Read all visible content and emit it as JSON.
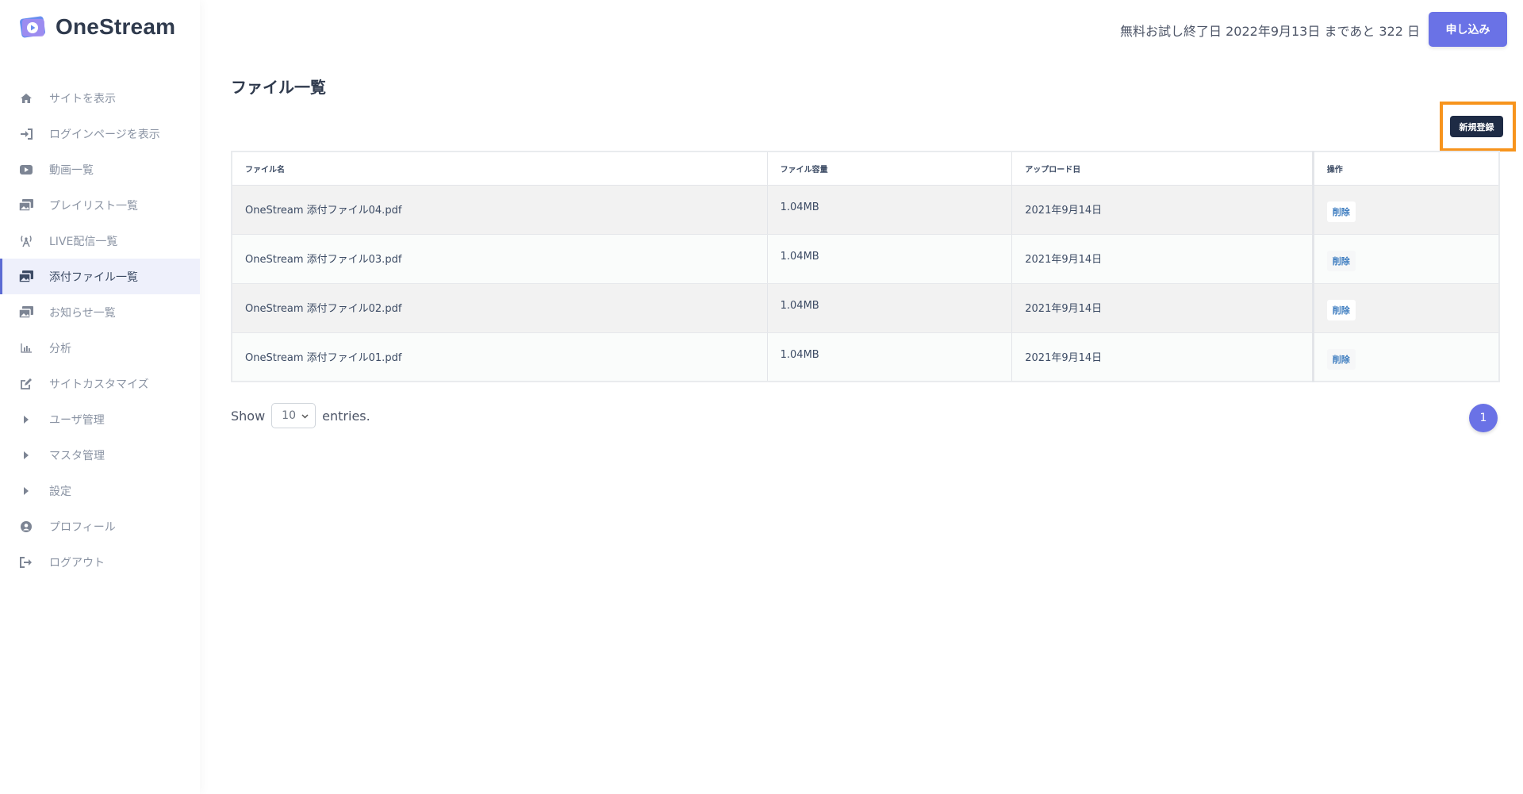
{
  "app": {
    "name": "OneStream"
  },
  "sidebar": {
    "items": [
      {
        "label": "サイトを表示",
        "icon": "home-icon"
      },
      {
        "label": "ログインページを表示",
        "icon": "sign-in-icon"
      },
      {
        "label": "動画一覧",
        "icon": "video-icon"
      },
      {
        "label": "プレイリスト一覧",
        "icon": "images-icon"
      },
      {
        "label": "LIVE配信一覧",
        "icon": "broadcast-icon"
      },
      {
        "label": "添付ファイル一覧",
        "icon": "images-icon",
        "active": true
      },
      {
        "label": "お知らせ一覧",
        "icon": "images-icon"
      },
      {
        "label": "分析",
        "icon": "bar-chart-icon"
      },
      {
        "label": "サイトカスタマイズ",
        "icon": "edit-icon"
      },
      {
        "label": "ユーザ管理",
        "icon": "caret-right-icon"
      },
      {
        "label": "マスタ管理",
        "icon": "caret-right-icon"
      },
      {
        "label": "設定",
        "icon": "caret-right-icon"
      },
      {
        "label": "プロフィール",
        "icon": "user-circle-icon"
      },
      {
        "label": "ログアウト",
        "icon": "sign-out-icon"
      }
    ]
  },
  "header": {
    "trial_text": "無料お試し終了日 2022年9月13日 まであと 322 日",
    "apply_label": "申し込み"
  },
  "main": {
    "title": "ファイル一覧",
    "new_label": "新規登録",
    "columns": [
      "ファイル名",
      "ファイル容量",
      "アップロード日",
      "操作"
    ],
    "rows": [
      {
        "name": "OneStream 添付ファイル04.pdf",
        "size": "1.04MB",
        "date": "2021年9月14日",
        "action": "削除"
      },
      {
        "name": "OneStream 添付ファイル03.pdf",
        "size": "1.04MB",
        "date": "2021年9月14日",
        "action": "削除"
      },
      {
        "name": "OneStream 添付ファイル02.pdf",
        "size": "1.04MB",
        "date": "2021年9月14日",
        "action": "削除"
      },
      {
        "name": "OneStream 添付ファイル01.pdf",
        "size": "1.04MB",
        "date": "2021年9月14日",
        "action": "削除"
      }
    ],
    "show_label": "Show",
    "entries_value": "10",
    "entries_label": "entries.",
    "page": "1"
  },
  "colors": {
    "accent": "#6a72e6",
    "highlight": "#f7941d",
    "dark_button": "#1e2b45"
  }
}
